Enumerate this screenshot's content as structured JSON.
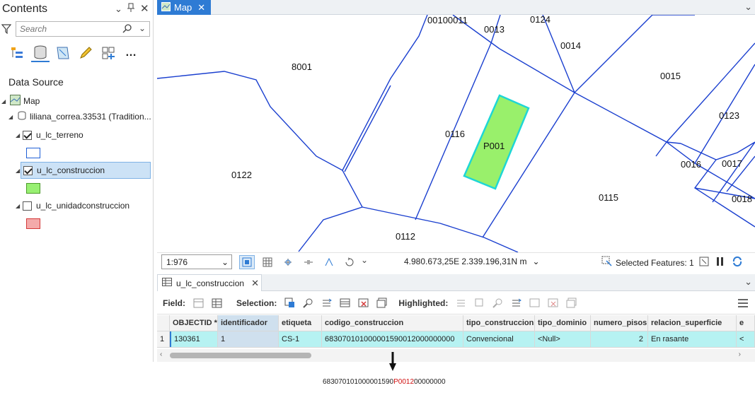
{
  "contents": {
    "title": "Contents",
    "search_placeholder": "Search",
    "section_label": "Data Source",
    "tree": {
      "map_label": "Map",
      "connection_label": "liliana_correa.33531 (Tradition...",
      "layers": [
        {
          "label": "u_lc_terreno",
          "checked": true,
          "swatch": "#1f5fd6",
          "swatch_fill": "#ffffff"
        },
        {
          "label": "u_lc_construccion",
          "checked": true,
          "swatch": "#4c9b2a",
          "swatch_fill": "#98f072",
          "selected": true
        },
        {
          "label": "u_lc_unidadconstruccion",
          "checked": false,
          "swatch": "#d43a3a",
          "swatch_fill": "#f4aaaa"
        }
      ]
    }
  },
  "map": {
    "tab_label": "Map",
    "parcel_labels": [
      {
        "text": "00100011"
      },
      {
        "text": "0013"
      },
      {
        "text": "0124"
      },
      {
        "text": "0014"
      },
      {
        "text": "8001"
      },
      {
        "text": "0015"
      },
      {
        "text": "0123"
      },
      {
        "text": "0116"
      },
      {
        "text": "P001"
      },
      {
        "text": "0016"
      },
      {
        "text": "0017"
      },
      {
        "text": "0122"
      },
      {
        "text": "0115"
      },
      {
        "text": "0018"
      },
      {
        "text": "0112"
      }
    ],
    "colors": {
      "parcel_line": "#1a3fcf",
      "building_fill": "#99f06b",
      "building_outline": "#1ed6d6"
    },
    "scale": "1:976",
    "coordinates": "4.980.673,25E 2.339.196,31N m",
    "selected_features_label": "Selected Features: 1"
  },
  "table": {
    "tab_label": "u_lc_construccion",
    "toolbar": {
      "field_label": "Field:",
      "selection_label": "Selection:",
      "highlighted_label": "Highlighted:"
    },
    "columns": [
      "OBJECTID *",
      "identificador",
      "etiqueta",
      "codigo_construccion",
      "tipo_construccion",
      "tipo_dominio",
      "numero_pisos",
      "relacion_superficie",
      "e"
    ],
    "rows": [
      {
        "row_num": "1",
        "cells": [
          "130361",
          "1",
          "CS-1",
          "683070101000001590012000000000",
          "Convencional",
          "<Null>",
          "2",
          "En rasante",
          "<"
        ]
      }
    ]
  },
  "footer_code": {
    "prefix": "683070101000001590",
    "highlight": "P0012",
    "suffix": "00000000"
  }
}
